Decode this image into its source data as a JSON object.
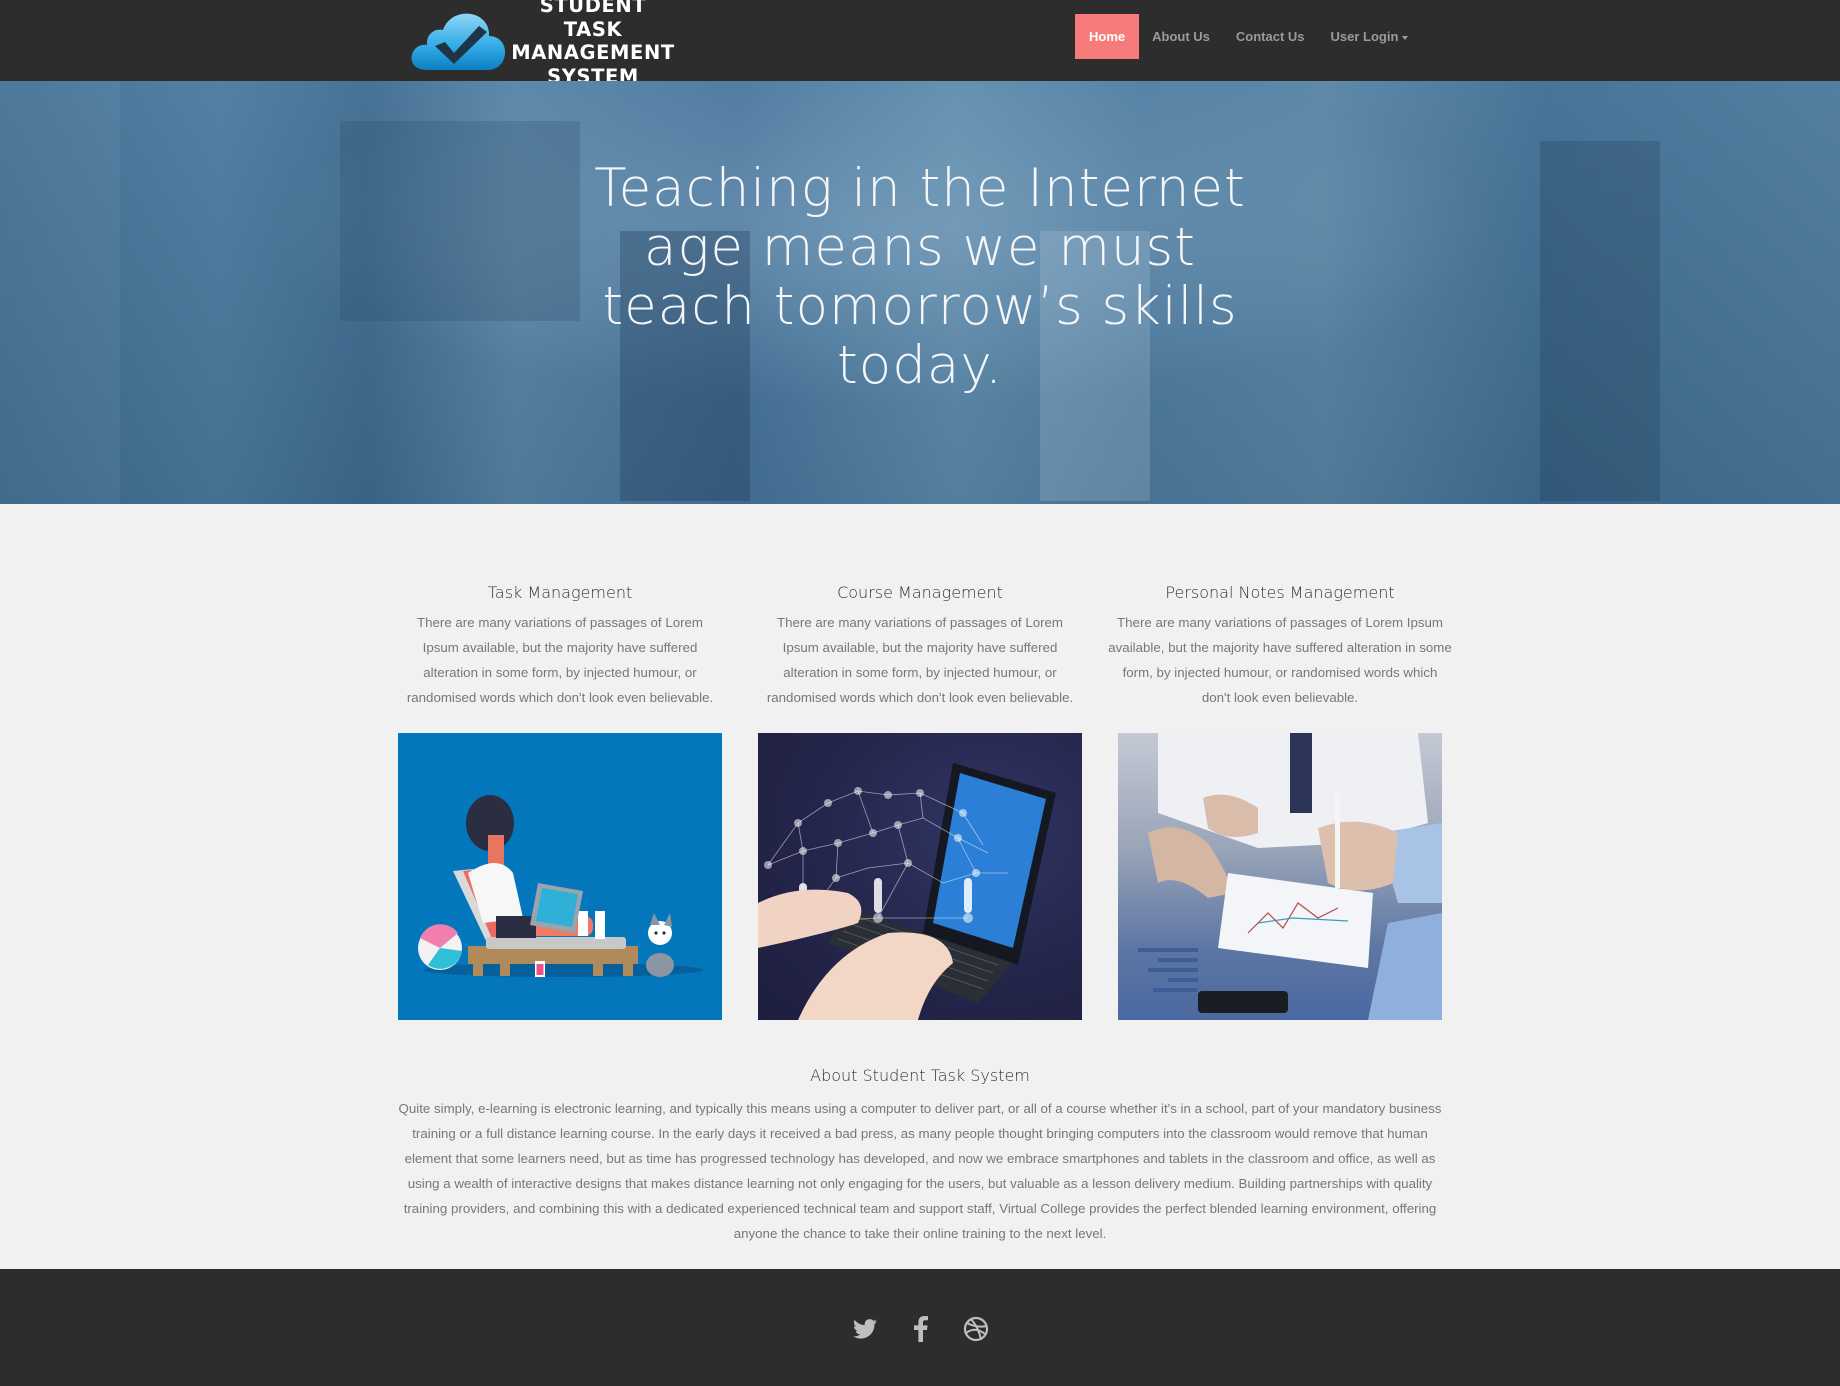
{
  "navbar": {
    "logo_lines": [
      "STUDENT TASK",
      "MANAGEMENT",
      "SYSTEM"
    ],
    "items": [
      {
        "label": "Home",
        "active": true
      },
      {
        "label": "About Us",
        "active": false
      },
      {
        "label": "Contact Us",
        "active": false
      },
      {
        "label": "User Login",
        "active": false,
        "dropdown": true
      }
    ]
  },
  "hero": {
    "title": "Teaching in the Internet age means we must teach tomorrow’s skills today."
  },
  "features": [
    {
      "title": "Task Management",
      "description": "There are many variations of passages of Lorem Ipsum available, but the majority have suffered alteration in some form, by injected humour, or randomised words which don't look even believable.",
      "image": "illustration-person-lounging-with-laptop-and-dog"
    },
    {
      "title": "Course Management",
      "description": "There are many variations of passages of Lorem Ipsum available, but the majority have suffered alteration in some form, by injected humour, or randomised words which don't look even believable.",
      "image": "hands-typing-on-laptop-with-network-of-people"
    },
    {
      "title": "Personal Notes Management",
      "description": "There are many variations of passages of Lorem Ipsum available, but the majority have suffered alteration in some form, by injected humour, or randomised words which don't look even believable.",
      "image": "business-people-reviewing-charts-with-pen"
    }
  ],
  "about": {
    "title": "About Student Task System",
    "text": "Quite simply, e-learning is electronic learning, and typically this means using a computer to deliver part, or all of a course whether it's in a school, part of your mandatory business training or a full distance learning course. In the early days it received a bad press, as many people thought bringing computers into the classroom would remove that human element that some learners need, but as time has progressed technology has developed, and now we embrace smartphones and tablets in the classroom and office, as well as using a wealth of interactive designs that makes distance learning not only engaging for the users, but valuable as a lesson delivery medium. Building partnerships with quality training providers, and combining this with a dedicated experienced technical team and support staff, Virtual College provides the perfect blended learning environment, offering anyone the chance to take their online training to the next level."
  },
  "footer": {
    "social": [
      "twitter-icon",
      "facebook-icon",
      "dribbble-icon"
    ]
  },
  "colors": {
    "nav_bg": "#2d2d2d",
    "nav_active": "#f77b7b",
    "hero_overlay": "#4a789c",
    "page_bg": "#f1f1f1"
  }
}
